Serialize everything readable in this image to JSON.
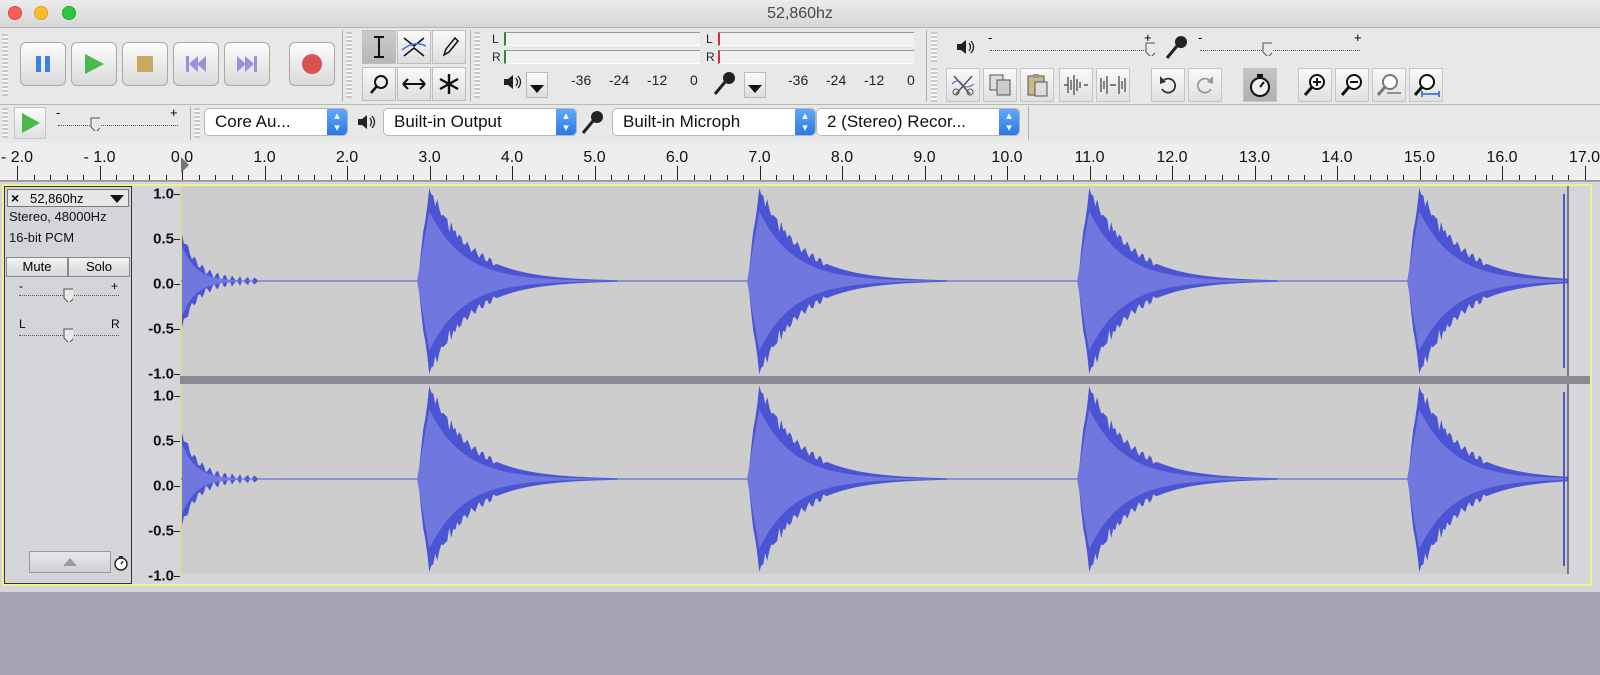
{
  "window": {
    "title": "52,860hz"
  },
  "transport": {
    "buttons": [
      "pause",
      "play",
      "stop",
      "skip-start",
      "skip-end",
      "record"
    ]
  },
  "tools": {
    "selection_tool": "selection",
    "envelope_tool": "envelope",
    "draw_tool": "draw",
    "zoom_tool": "zoom",
    "timeshift_tool": "time-shift",
    "multi_tool": "multi"
  },
  "meters": {
    "playback": {
      "left": "L",
      "right": "R",
      "ticks": [
        "-36",
        "-24",
        "-12",
        "0"
      ]
    },
    "record": {
      "left": "L",
      "right": "R",
      "ticks": [
        "-36",
        "-24",
        "-12",
        "0"
      ]
    }
  },
  "mixer": {
    "output_minus": "-",
    "output_plus": "+",
    "input_minus": "-",
    "input_plus": "+"
  },
  "play_at_speed": {
    "minus": "-",
    "plus": "+"
  },
  "devices": {
    "host": "Core Au...",
    "output": "Built-in Output",
    "input": "Built-in Microph",
    "channels": "2 (Stereo) Recor..."
  },
  "ruler": {
    "labels": [
      "- 2.0",
      "- 1.0",
      "0.0",
      "1.0",
      "2.0",
      "3.0",
      "4.0",
      "5.0",
      "6.0",
      "7.0",
      "8.0",
      "9.0",
      "10.0",
      "11.0",
      "12.0",
      "13.0",
      "14.0",
      "15.0",
      "16.0",
      "17.0"
    ]
  },
  "track": {
    "name": "52,860hz",
    "close": "×",
    "format": "Stereo, 48000Hz",
    "bit_depth": "16-bit PCM",
    "mute_label": "Mute",
    "solo_label": "Solo",
    "gain_minus": "-",
    "gain_plus": "+",
    "pan_left": "L",
    "pan_right": "R",
    "scale_labels": [
      "1.0",
      "0.5",
      "0.0",
      "-0.5",
      "-1.0"
    ],
    "waveform_color": "#4b55d4",
    "waveform_fill": "#7078e0",
    "background_color": "#cdcdcd",
    "strikes_seconds": [
      0.0,
      2.9,
      6.9,
      10.9,
      14.9
    ],
    "clip_end_seconds": 16.8
  },
  "colors": {
    "selection_border": "#f3f28a",
    "empty_area": "#a3a3b3"
  }
}
